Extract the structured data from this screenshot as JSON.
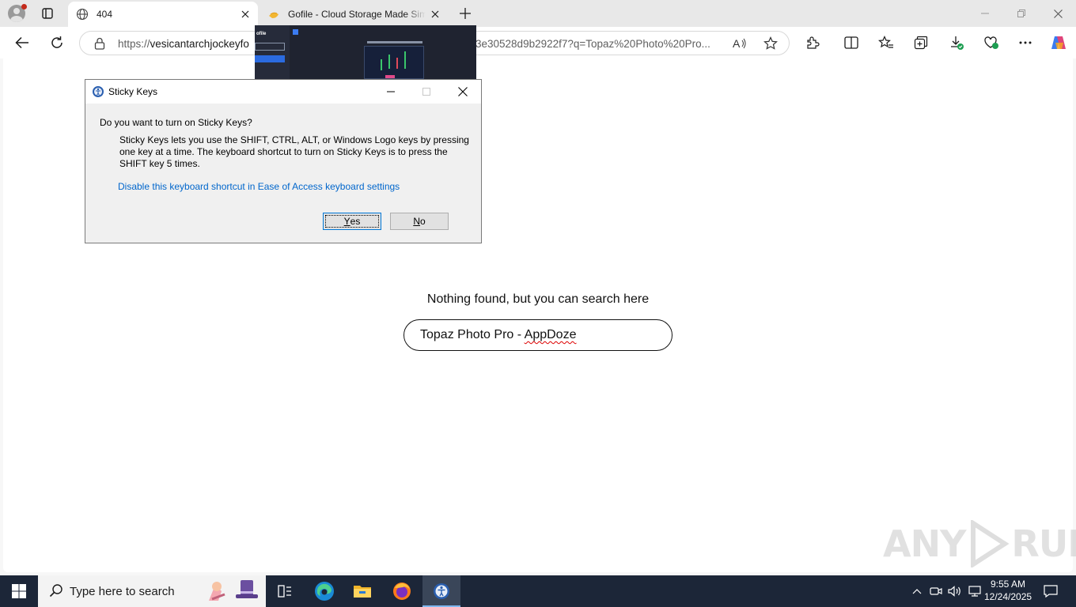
{
  "browser": {
    "tabs": [
      {
        "title": "404",
        "active": true
      },
      {
        "title": "Gofile - Cloud Storage Made Simple",
        "active": false
      }
    ],
    "address": {
      "scheme": "https://",
      "host_visible": "vesicantarchjockeyfo",
      "url_tail": "3e30528d9b2922f7?q=Topaz%20Photo%20Pro..."
    }
  },
  "page": {
    "message": "Nothing found, but you can search here",
    "search_value_a": "Topaz Photo Pro - ",
    "search_value_b": "AppDoze"
  },
  "tab_preview": {
    "logo": "ofile"
  },
  "dialog": {
    "title": "Sticky Keys",
    "question": "Do you want to turn on Sticky Keys?",
    "description": "Sticky Keys lets you use the SHIFT, CTRL, ALT, or Windows Logo keys by pressing one key at a time. The keyboard shortcut to turn on Sticky Keys is to press the SHIFT key 5 times.",
    "link": "Disable this keyboard shortcut in Ease of Access keyboard settings",
    "yes_mnemonic": "Y",
    "yes_rest": "es",
    "no_mnemonic": "N",
    "no_rest": "o"
  },
  "watermark": {
    "left": "ANY",
    "right": "RUN"
  },
  "taskbar": {
    "search_placeholder": "Type here to search",
    "time": "9:55 AM",
    "date": "12/24/2025"
  },
  "colors": {
    "taskbar_bg": "#1c2638",
    "link": "#0066cc",
    "tab_bar": "#e8e8e8"
  },
  "icons": [
    "profile-icon",
    "tab-actions-icon",
    "globe-icon",
    "close-icon",
    "gofile-favicon",
    "new-tab-icon",
    "minimize-icon",
    "restore-icon",
    "back-icon",
    "refresh-icon",
    "lock-icon",
    "read-aloud-icon",
    "favorite-star-icon",
    "extensions-icon",
    "split-screen-icon",
    "favorites-icon",
    "collections-icon",
    "downloads-icon",
    "performance-icon",
    "more-icon",
    "copilot-icon",
    "windows-start-icon",
    "search-icon",
    "task-view-icon",
    "edge-icon",
    "file-explorer-icon",
    "firefox-icon",
    "accessibility-icon",
    "chevron-up-icon",
    "meet-now-icon",
    "volume-icon",
    "network-icon",
    "notification-icon"
  ]
}
